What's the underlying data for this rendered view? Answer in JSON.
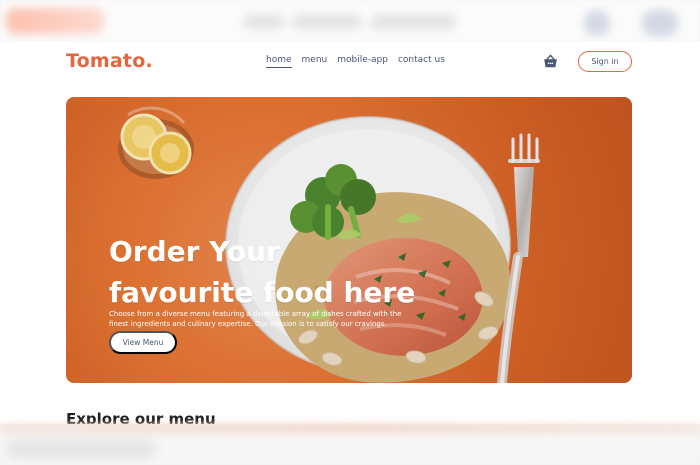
{
  "brand": {
    "name": "Tomato.",
    "accent": "#e5653d"
  },
  "navbar": {
    "links": [
      {
        "label": "home",
        "active": true
      },
      {
        "label": "menu",
        "active": false
      },
      {
        "label": "mobile-app",
        "active": false
      },
      {
        "label": "contact us",
        "active": false
      }
    ],
    "cart_icon": "basket-icon",
    "sign_in_label": "Sign in"
  },
  "hero": {
    "title_line_1": "Order Your",
    "title_line_2": "favourite food here",
    "description": "Choose from a diverse menu featuring a delectable array of dishes crafted with the finest ingredients and culinary expertise. Our mission is to satisfy our cravings.",
    "cta_label": "View Menu",
    "image_theme": "salmon-plate-lemon-fork"
  },
  "sections": {
    "explore_title": "Explore our menu"
  }
}
